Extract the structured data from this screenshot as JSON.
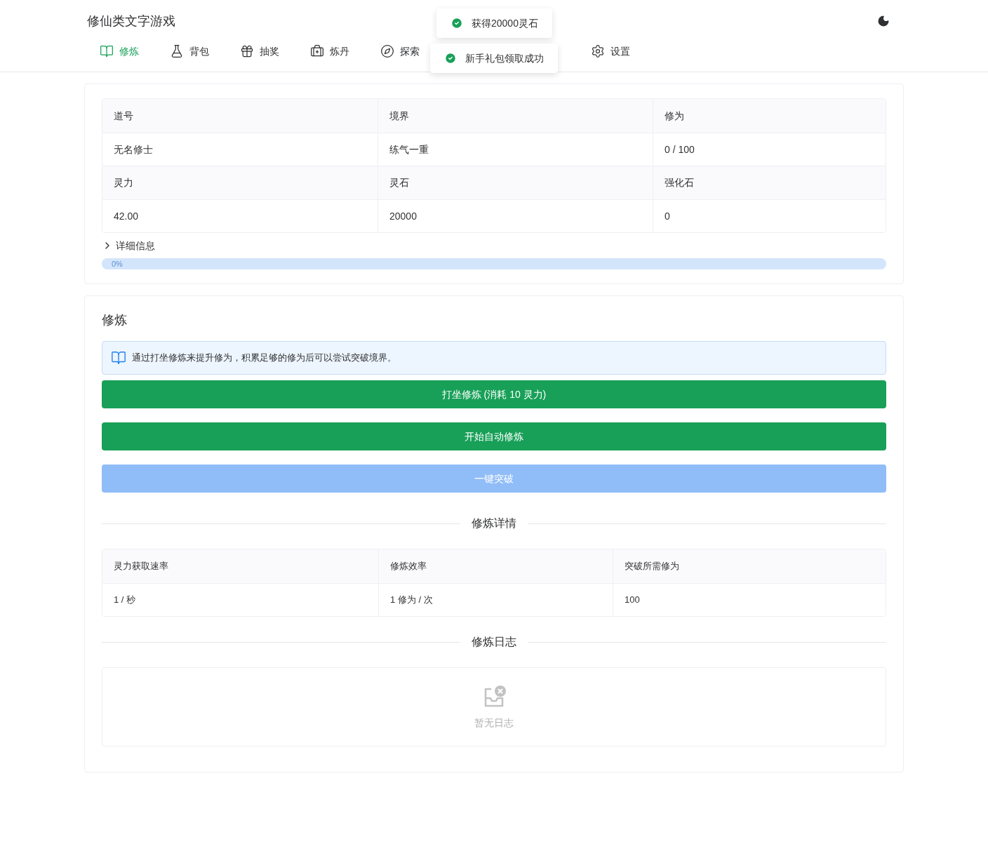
{
  "header": {
    "title": "修仙类文字游戏"
  },
  "nav": [
    {
      "label": "修炼",
      "selected": true
    },
    {
      "label": "背包",
      "selected": false
    },
    {
      "label": "抽奖",
      "selected": false
    },
    {
      "label": "炼丹",
      "selected": false
    },
    {
      "label": "探索",
      "selected": false
    },
    {
      "label": "设置",
      "selected": false
    }
  ],
  "toasts": [
    "获得20000灵石",
    "新手礼包领取成功"
  ],
  "stats": {
    "rows": [
      [
        "道号",
        "境界",
        "修为"
      ],
      [
        "无名修士",
        "练气一重",
        "0 / 100"
      ],
      [
        "灵力",
        "灵石",
        "强化石"
      ],
      [
        "42.00",
        "20000",
        "0"
      ]
    ]
  },
  "details": {
    "label": "详细信息",
    "expanded": false
  },
  "progress": {
    "level": 0,
    "reading": "0%"
  },
  "cultivation": {
    "title": "修炼",
    "alert": "通过打坐修炼来提升修为，积累足够的修为后可以尝试突破境界。",
    "buttons": [
      {
        "label": "打坐修炼 (消耗 10 灵力)",
        "disabled": false
      },
      {
        "label": "开始自动修炼",
        "disabled": false
      },
      {
        "label": "一键突破",
        "disabled": true
      }
    ],
    "details_title": "修炼详情",
    "details_table": {
      "columns": [
        "灵力获取速率",
        "修炼效率",
        "突破所需修为"
      ],
      "rows": [
        [
          "1 / 秒",
          "1 修为 / 次",
          "100"
        ]
      ]
    },
    "log_title": "修炼日志",
    "log_empty": "暂无日志"
  }
}
